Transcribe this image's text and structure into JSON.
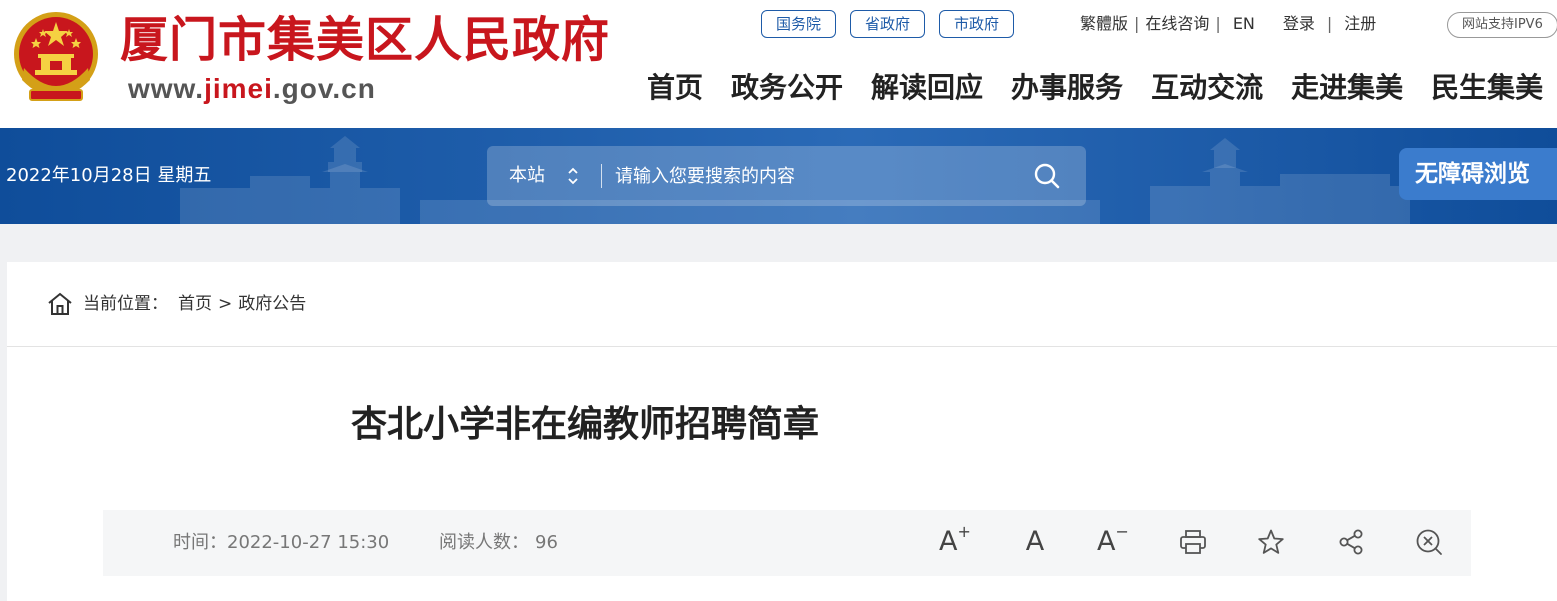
{
  "header": {
    "site_name": "厦门市集美区人民政府",
    "url_prefix": "www.",
    "url_accent": "jimei",
    "url_suffix": ".gov.cn",
    "gov_links": [
      "国务院",
      "省政府",
      "市政府"
    ],
    "top_links": {
      "traditional": "繁體版",
      "consult": "在线咨询",
      "english": "EN",
      "login": "登录",
      "register": "注册"
    },
    "ipv6_badge": "网站支持IPV6",
    "nav": [
      "首页",
      "政务公开",
      "解读回应",
      "办事服务",
      "互动交流",
      "走进集美",
      "民生集美"
    ]
  },
  "banner": {
    "date": "2022年10月28日 星期五",
    "search_scope": "本站",
    "search_placeholder": "请输入您要搜索的内容",
    "accessible_label": "无障碍浏览"
  },
  "breadcrumb": {
    "prefix": "当前位置：",
    "home": "首页",
    "separator": ">",
    "current": "政府公告"
  },
  "article": {
    "title": "杏北小学非在编教师招聘简章",
    "time_label": "时间：",
    "time_value": "2022-10-27 15:30",
    "reads_label": "阅读人数：",
    "reads_value": "96",
    "font_tools": {
      "large": "A",
      "normal": "A",
      "small": "A",
      "plus": "+",
      "minus": "−"
    }
  },
  "colors": {
    "brand_red": "#c8161d",
    "link_blue": "#1e5ba8",
    "banner_blue": "#1d5ca9",
    "accessible_blue": "#3b7ccd"
  },
  "icons": [
    "national-emblem-icon",
    "chevron-updown-icon",
    "search-icon",
    "home-icon",
    "font-enlarge-icon",
    "font-reset-icon",
    "font-reduce-icon",
    "print-icon",
    "star-icon",
    "share-icon",
    "zoom-out-icon"
  ]
}
